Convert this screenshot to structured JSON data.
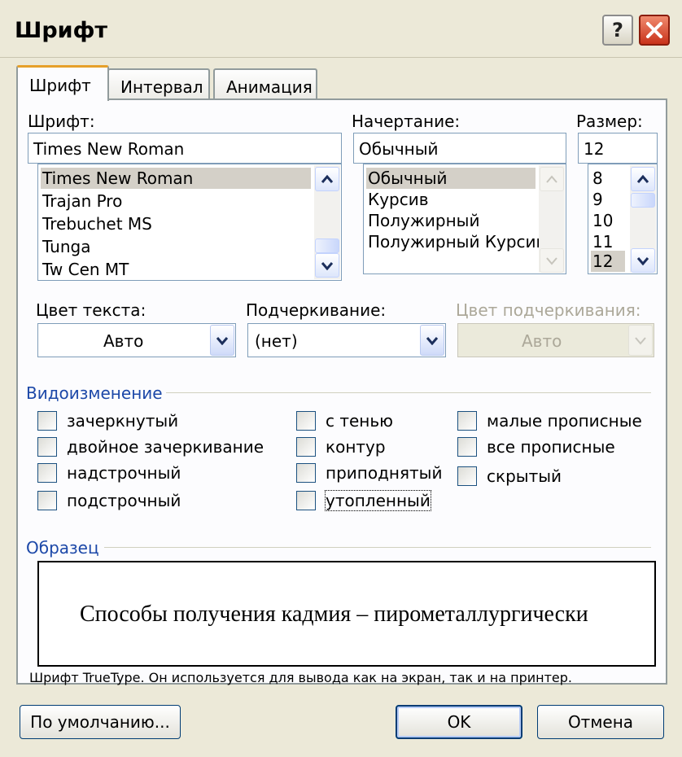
{
  "window": {
    "title": "Шрифт",
    "help_label": "?"
  },
  "tabs": [
    {
      "label": "Шрифт",
      "active": true
    },
    {
      "label": "Интервал",
      "active": false
    },
    {
      "label": "Анимация",
      "active": false
    }
  ],
  "font": {
    "label": "Шрифт:",
    "value": "Times New Roman",
    "items": [
      "Times New Roman",
      "Trajan Pro",
      "Trebuchet MS",
      "Tunga",
      "Tw Cen MT"
    ],
    "selected": "Times New Roman"
  },
  "style": {
    "label": "Начертание:",
    "value": "Обычный",
    "items": [
      "Обычный",
      "Курсив",
      "Полужирный",
      "Полужирный Курсив"
    ],
    "selected": "Обычный"
  },
  "size": {
    "label": "Размер:",
    "value": "12",
    "items": [
      "8",
      "9",
      "10",
      "11",
      "12"
    ],
    "selected": "12"
  },
  "text_color": {
    "label": "Цвет текста:",
    "value": "Авто"
  },
  "underline": {
    "label": "Подчеркивание:",
    "value": "(нет)"
  },
  "underline_color": {
    "label": "Цвет подчеркивания:",
    "value": "Авто",
    "disabled": true
  },
  "effects": {
    "title": "Видоизменение",
    "items": [
      {
        "label": "зачеркнутый",
        "checked": false
      },
      {
        "label": "двойное зачеркивание",
        "checked": false
      },
      {
        "label": "надстрочный",
        "checked": false
      },
      {
        "label": "подстрочный",
        "checked": false
      },
      {
        "label": "с тенью",
        "checked": false
      },
      {
        "label": "контур",
        "checked": false
      },
      {
        "label": "приподнятый",
        "checked": false
      },
      {
        "label": "утопленный",
        "checked": false
      },
      {
        "label": "малые прописные",
        "checked": false
      },
      {
        "label": "все прописные",
        "checked": false
      },
      {
        "label": "скрытый",
        "checked": false
      }
    ]
  },
  "sample": {
    "title": "Образец",
    "text": "Способы получения кадмия – пирометаллургически",
    "note": "Шрифт TrueType. Он используется для вывода как на экран, так и на принтер."
  },
  "buttons": {
    "default": "По умолчанию...",
    "ok": "OK",
    "cancel": "Отмена"
  },
  "colors": {
    "group_title": "#1c48a8",
    "tab_highlight": "#e6a02a",
    "close_button": "#c8321a"
  },
  "icons": {
    "help": "help-icon",
    "close": "close-icon",
    "scroll_up": "chevron-up-icon",
    "scroll_down": "chevron-down-icon",
    "dropdown": "dropdown-arrow-icon"
  }
}
